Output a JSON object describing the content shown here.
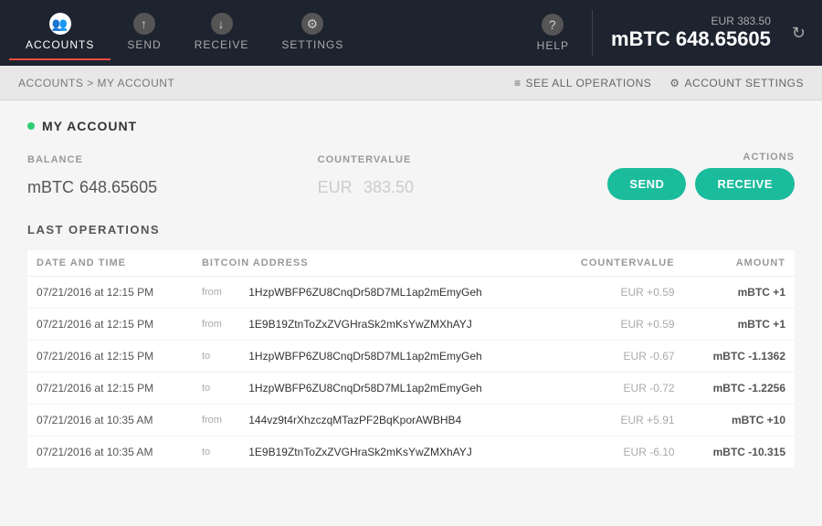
{
  "nav": {
    "items": [
      {
        "id": "accounts",
        "label": "ACCOUNTS",
        "icon": "👥",
        "active": true
      },
      {
        "id": "send",
        "label": "SEND",
        "icon": "↑",
        "active": false
      },
      {
        "id": "receive",
        "label": "RECEIVE",
        "icon": "↓",
        "active": false
      },
      {
        "id": "settings",
        "label": "SETTINGS",
        "icon": "⚙",
        "active": false
      }
    ],
    "help": {
      "label": "HELP",
      "icon": "?"
    },
    "balance": {
      "small": "EUR 383.50",
      "large": "mBTC 648.65605"
    },
    "refresh_icon": "↻"
  },
  "breadcrumb": {
    "path": "ACCOUNTS > MY ACCOUNT",
    "see_all_label": "SEE ALL OPERATIONS",
    "account_settings_label": "ACCOUNT SETTINGS"
  },
  "account": {
    "name": "MY ACCOUNT",
    "balance_label": "BALANCE",
    "balance_currency": "mBTC",
    "balance_value": "648.65605",
    "countervalue_label": "COUNTERVALUE",
    "countervalue_currency": "EUR",
    "countervalue_value": "383.50",
    "actions_label": "ACTIONS",
    "send_label": "SEND",
    "receive_label": "RECEIVE"
  },
  "operations": {
    "title": "LAST OPERATIONS",
    "columns": [
      {
        "id": "date",
        "label": "DATE AND TIME"
      },
      {
        "id": "address",
        "label": "BITCOIN ADDRESS"
      },
      {
        "id": "countervalue",
        "label": "COUNTERVALUE"
      },
      {
        "id": "amount",
        "label": "AMOUNT"
      }
    ],
    "rows": [
      {
        "date": "07/21/2016 at 12:15 PM",
        "direction": "from",
        "address": "1HzpWBFP6ZU8CnqDr58D7ML1ap2mEmyGeh",
        "countervalue": "EUR +0.59",
        "amount": "mBTC +1",
        "amount_type": "positive"
      },
      {
        "date": "07/21/2016 at 12:15 PM",
        "direction": "from",
        "address": "1E9B19ZtnToZxZVGHraSk2mKsYwZMXhAYJ",
        "countervalue": "EUR +0.59",
        "amount": "mBTC +1",
        "amount_type": "positive"
      },
      {
        "date": "07/21/2016 at 12:15 PM",
        "direction": "to",
        "address": "1HzpWBFP6ZU8CnqDr58D7ML1ap2mEmyGeh",
        "countervalue": "EUR -0.67",
        "amount": "mBTC -1.1362",
        "amount_type": "negative"
      },
      {
        "date": "07/21/2016 at 12:15 PM",
        "direction": "to",
        "address": "1HzpWBFP6ZU8CnqDr58D7ML1ap2mEmyGeh",
        "countervalue": "EUR -0.72",
        "amount": "mBTC -1.2256",
        "amount_type": "negative"
      },
      {
        "date": "07/21/2016 at 10:35 AM",
        "direction": "from",
        "address": "144vz9t4rXhzczqMTazPF2BqKporAWBHB4",
        "countervalue": "EUR +5.91",
        "amount": "mBTC +10",
        "amount_type": "positive"
      },
      {
        "date": "07/21/2016 at 10:35 AM",
        "direction": "to",
        "address": "1E9B19ZtnToZxZVGHraSk2mKsYwZMXhAYJ",
        "countervalue": "EUR -6.10",
        "amount": "mBTC -10.315",
        "amount_type": "negative"
      }
    ]
  }
}
